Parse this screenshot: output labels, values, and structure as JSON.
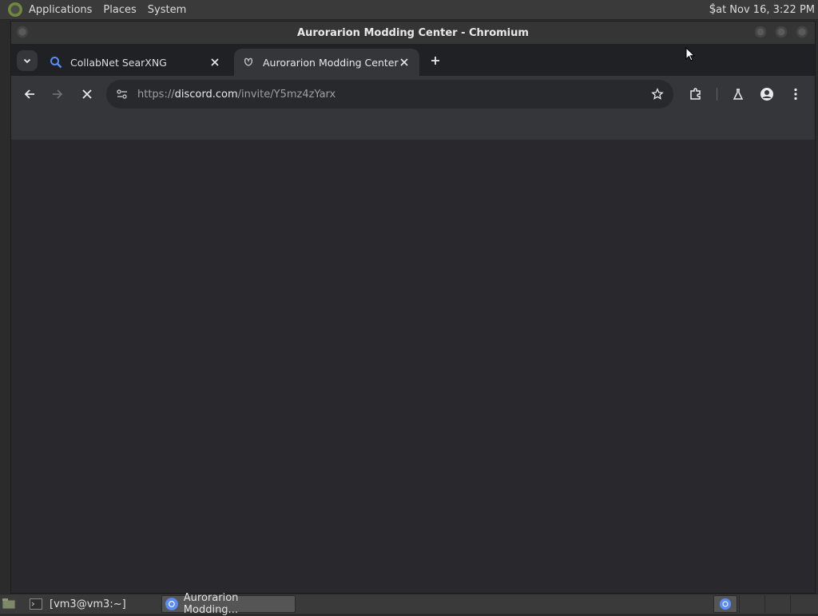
{
  "top_panel": {
    "menus": [
      "Applications",
      "Places",
      "System"
    ],
    "clock": "Sat Nov 16,  3:22 PM"
  },
  "window": {
    "title": "Aurorarion Modding Center - Chromium"
  },
  "tabs": [
    {
      "label": "CollabNet SearXNG",
      "icon": "search-icon",
      "active": false
    },
    {
      "label": "Aurorarion Modding Center",
      "icon": "discord-icon",
      "active": true
    }
  ],
  "omnibox": {
    "url_scheme": "https://",
    "url_host": "discord.com",
    "url_path": "/invite/Y5mz4zYarx"
  },
  "taskbar": {
    "items": [
      {
        "label": "[vm3@vm3:~]",
        "icon": "terminal-icon",
        "active": false
      },
      {
        "label": "Aurorarion Modding...",
        "icon": "chromium-icon",
        "active": true
      }
    ]
  },
  "colors": {
    "tab_strip": "#202124",
    "toolbar": "#35363a",
    "content": "#29292d",
    "accent_search": "#5b8cf5"
  }
}
